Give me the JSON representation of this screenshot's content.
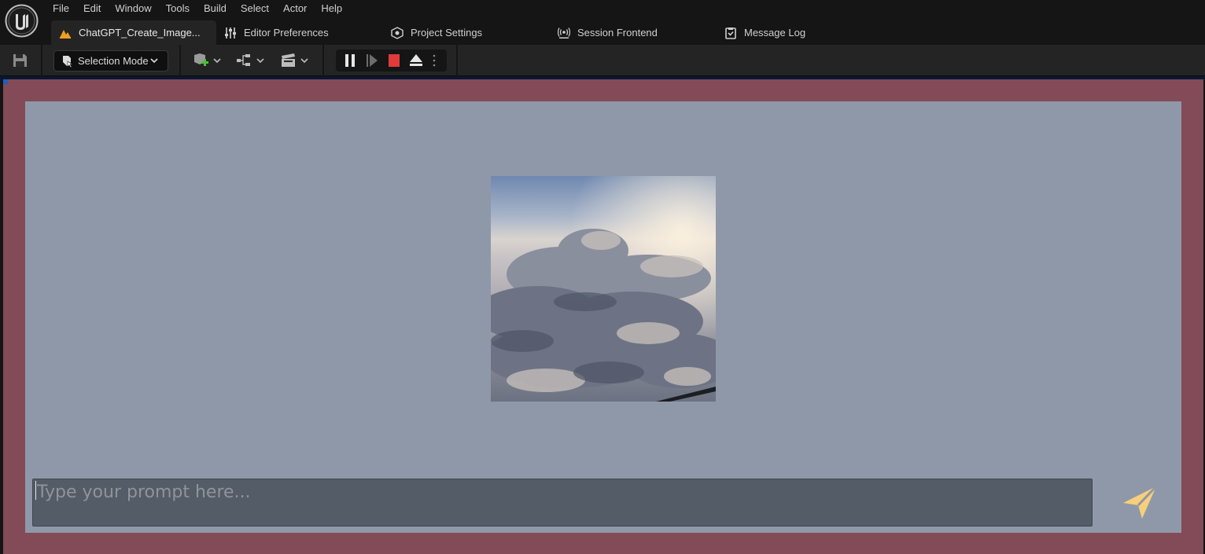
{
  "menubar": {
    "items": [
      "File",
      "Edit",
      "Window",
      "Tools",
      "Build",
      "Select",
      "Actor",
      "Help"
    ]
  },
  "tabs": [
    {
      "label": "ChatGPT_Create_Image...",
      "icon": "level-icon"
    },
    {
      "label": "Editor Preferences",
      "icon": "sliders-icon"
    },
    {
      "label": "Project Settings",
      "icon": "settings-cube-icon"
    },
    {
      "label": "Session Frontend",
      "icon": "broadcast-icon"
    },
    {
      "label": "Message Log",
      "icon": "log-icon"
    }
  ],
  "toolbar": {
    "mode_label": "Selection Mode"
  },
  "prompt": {
    "placeholder": "Type your prompt here..."
  },
  "colors": {
    "viewport_border": "#824b57",
    "panel_bg": "#8f98a8",
    "input_bg": "#545c67",
    "send_icon": "#f7cf7a",
    "stop_button": "#e03b3b"
  }
}
